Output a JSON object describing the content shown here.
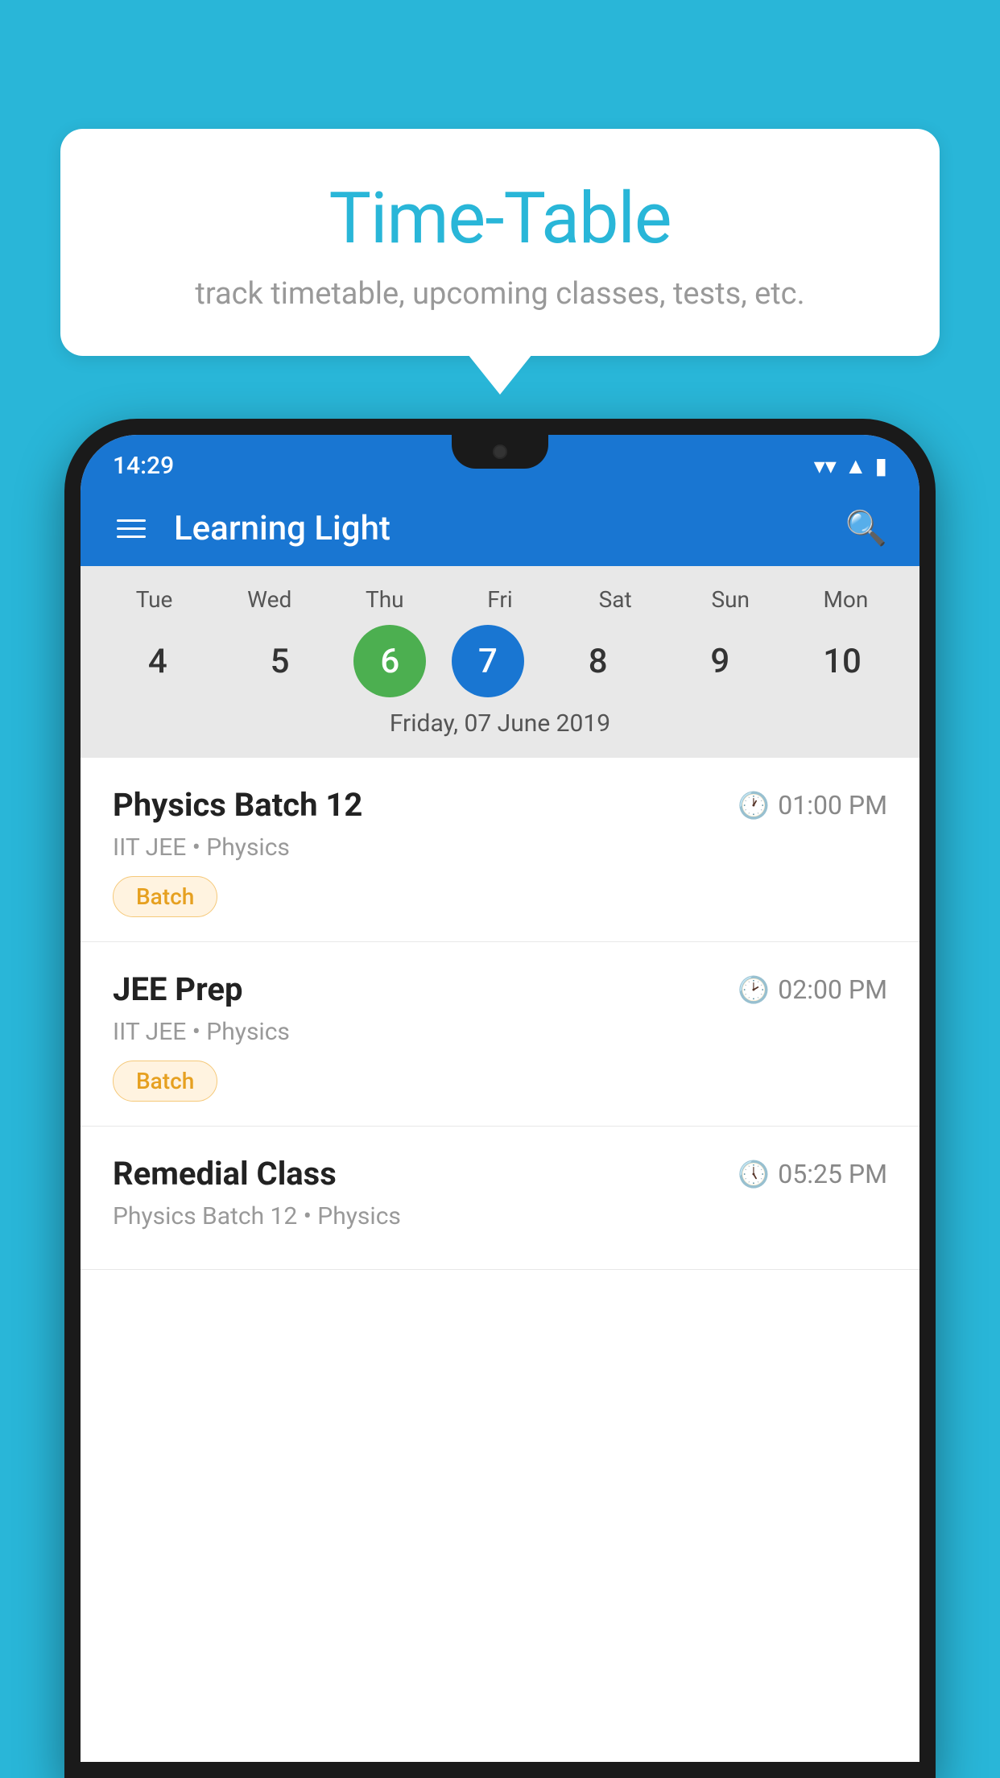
{
  "background_color": "#29b6d8",
  "tooltip": {
    "title": "Time-Table",
    "subtitle": "track timetable, upcoming classes, tests, etc."
  },
  "app": {
    "name": "Learning Light",
    "status_time": "14:29"
  },
  "calendar": {
    "days": [
      "Tue",
      "Wed",
      "Thu",
      "Fri",
      "Sat",
      "Sun",
      "Mon"
    ],
    "dates": [
      "4",
      "5",
      "6",
      "7",
      "8",
      "9",
      "10"
    ],
    "today_index": 2,
    "selected_index": 3,
    "selected_date_label": "Friday, 07 June 2019"
  },
  "schedule": [
    {
      "title": "Physics Batch 12",
      "time": "01:00 PM",
      "subtitle": "IIT JEE • Physics",
      "badge": "Batch"
    },
    {
      "title": "JEE Prep",
      "time": "02:00 PM",
      "subtitle": "IIT JEE • Physics",
      "badge": "Batch"
    },
    {
      "title": "Remedial Class",
      "time": "05:25 PM",
      "subtitle": "Physics Batch 12 • Physics",
      "badge": ""
    }
  ],
  "icons": {
    "hamburger": "menu-icon",
    "search": "search-icon",
    "clock": "clock-icon"
  }
}
